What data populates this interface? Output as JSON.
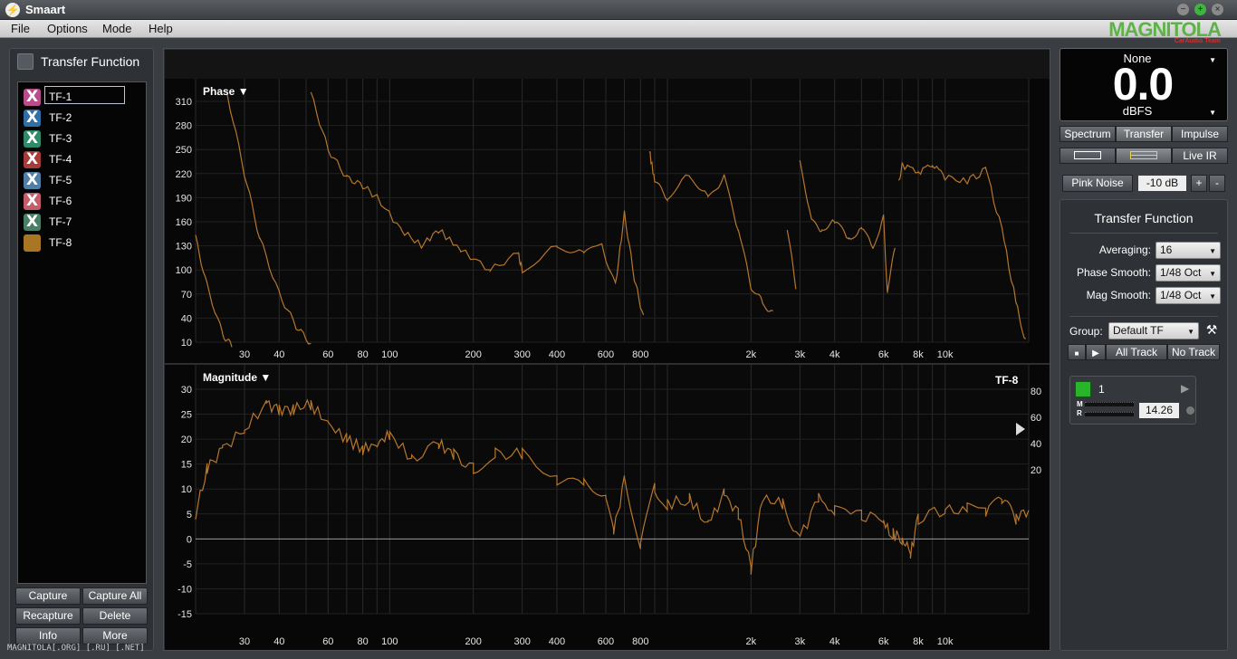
{
  "window": {
    "title": "Smaart"
  },
  "menu": [
    "File",
    "Options",
    "Mode",
    "Help"
  ],
  "logo": {
    "text": "MAGNITOLA",
    "sub": "CarAudio Team"
  },
  "left_panel": {
    "title": "Transfer Function",
    "items": [
      {
        "label": "TF-1",
        "color": "#b84d8c",
        "badge": "X",
        "editing": true
      },
      {
        "label": "TF-2",
        "color": "#2f6fa8",
        "badge": "X"
      },
      {
        "label": "TF-3",
        "color": "#2f8a6a",
        "badge": "X"
      },
      {
        "label": "TF-4",
        "color": "#a83a3a",
        "badge": "X"
      },
      {
        "label": "TF-5",
        "color": "#4f7fa6",
        "badge": "X"
      },
      {
        "label": "TF-6",
        "color": "#c65b6a",
        "badge": "X"
      },
      {
        "label": "TF-7",
        "color": "#4a7e66",
        "badge": "X"
      },
      {
        "label": "TF-8",
        "color": "#a97623",
        "badge": ""
      }
    ],
    "buttons": [
      "Capture",
      "Capture All",
      "Recapture",
      "Delete",
      "Info",
      "More"
    ]
  },
  "watermark": "MAGNITOLA[.ORG] [.RU] [.NET]",
  "phase_plot": {
    "title": "Phase ▼",
    "y_ticks": [
      "310",
      "280",
      "250",
      "220",
      "190",
      "160",
      "130",
      "100",
      "70",
      "40",
      "10"
    ],
    "x_ticks": [
      "30",
      "40",
      "60",
      "80",
      "100",
      "200",
      "300",
      "400",
      "600",
      "800",
      "2k",
      "3k",
      "4k",
      "6k",
      "8k",
      "10k"
    ]
  },
  "magnitude_plot": {
    "title": "Magnitude ▼",
    "trace_label": "TF-8",
    "y_ticks": [
      "30",
      "25",
      "20",
      "15",
      "10",
      "5",
      "0",
      "-5",
      "-10",
      "-15"
    ],
    "y2_ticks": [
      "80",
      "60",
      "40",
      "20"
    ],
    "x_ticks": [
      "30",
      "40",
      "60",
      "80",
      "100",
      "200",
      "300",
      "400",
      "600",
      "800",
      "2k",
      "3k",
      "4k",
      "6k",
      "8k",
      "10k"
    ]
  },
  "trace_color": "#b5762e",
  "meter": {
    "source": "None",
    "value": "0.0",
    "unit": "dBFS"
  },
  "view_tabs": [
    "Spectrum",
    "Transfer",
    "Impulse"
  ],
  "layout_buttons": {
    "live_ir": "Live IR"
  },
  "generator": {
    "label": "Pink Noise",
    "level": "-10 dB",
    "plus": "+",
    "minus": "-"
  },
  "tf_panel": {
    "title": "Transfer Function",
    "averaging_label": "Averaging:",
    "averaging_value": "16",
    "phase_smooth_label": "Phase Smooth:",
    "phase_smooth_value": "1/48 Oct",
    "mag_smooth_label": "Mag Smooth:",
    "mag_smooth_value": "1/48 Oct",
    "group_label": "Group:",
    "group_value": "Default TF",
    "all_track": "All Track",
    "no_track": "No Track",
    "track": {
      "name": "1",
      "m": "M",
      "r": "R",
      "delay": "14.26"
    }
  }
}
